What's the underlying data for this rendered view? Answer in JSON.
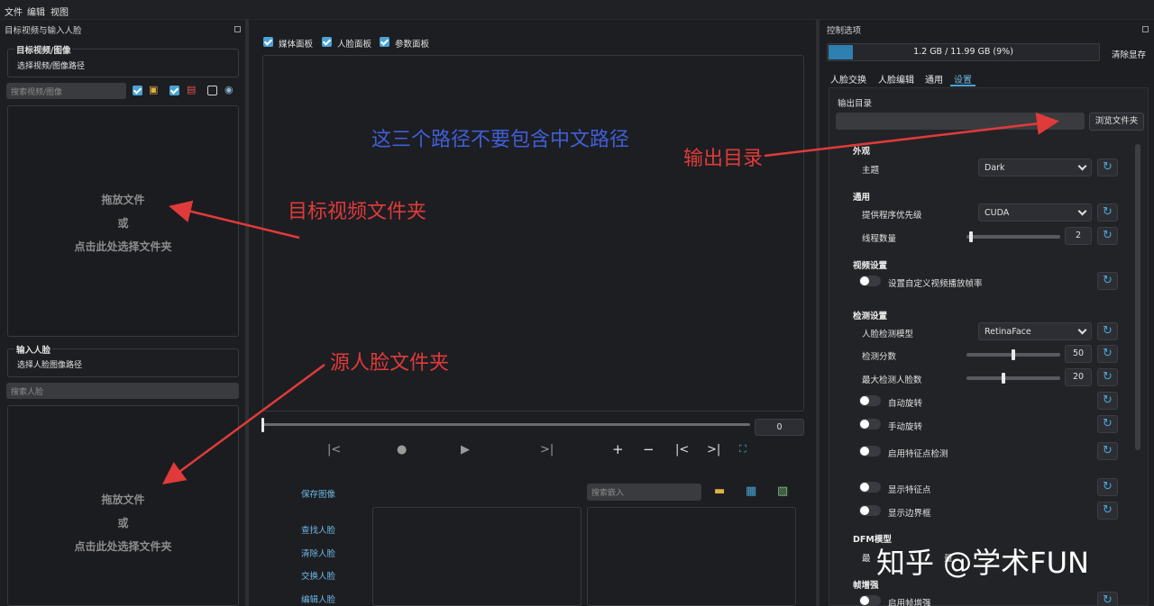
{
  "menu": {
    "file": "文件",
    "edit": "编辑",
    "view": "视图"
  },
  "left": {
    "dock_title": "目标视频与输入人脸",
    "target_group_title": "目标视频/图像",
    "target_path_placeholder": "选择视频/图像路径",
    "search_media_placeholder": "搜索视频/图像",
    "dropzone_line1": "拖放文件",
    "dropzone_line2": "或",
    "dropzone_line3": "点击此处选择文件夹",
    "input_face_group_title": "输入人脸",
    "face_path_placeholder": "选择人脸图像路径",
    "search_face_placeholder": "搜索人脸",
    "dropzone2_line1": "拖放文件",
    "dropzone2_line2": "或",
    "dropzone2_line3": "点击此处选择文件夹"
  },
  "center": {
    "checkbox_media": "媒体面板",
    "checkbox_face": "人脸面板",
    "checkbox_params": "参数面板",
    "frame_value": "0",
    "save_image": "保存图像",
    "search_embed_placeholder": "搜索嵌入",
    "find_face": "查找人脸",
    "clear_face": "清除人脸",
    "swap_face": "交换人脸",
    "edit_face": "编辑人脸"
  },
  "right": {
    "dock_title": "控制选项",
    "vram_text": "1.2 GB / 11.99 GB (9%)",
    "vram_fraction": 0.09,
    "clear_vram": "清除显存",
    "tabs": [
      "人脸交换",
      "人脸编辑",
      "通用",
      "设置"
    ],
    "active_tab": "设置",
    "output_dir_label": "输出目录",
    "browse_folder": "浏览文件夹",
    "sections": {
      "appearance": "外观",
      "general": "通用",
      "video_settings": "视频设置",
      "detection_settings": "检测设置",
      "dfm_model": "DFM模型",
      "frame_enhance": "帧增强"
    },
    "theme_label": "主题",
    "theme_value": "Dark",
    "provider_label": "提供程序优先级",
    "provider_value": "CUDA",
    "threads_label": "线程数量",
    "threads_value": "2",
    "custom_fps_label": "设置自定义视频播放帧率",
    "detect_model_label": "人脸检测模型",
    "detect_model_value": "RetinaFace",
    "detect_score_label": "检测分数",
    "detect_score_value": "50",
    "max_faces_label": "最大检测人脸数",
    "max_faces_value": "20",
    "auto_rotate_label": "自动旋转",
    "manual_rotate_label": "手动旋转",
    "landmark_detect_label": "启用特征点检测",
    "show_landmarks_label": "显示特征点",
    "show_bbox_label": "显示边界框",
    "dfm_partial_label": "最",
    "dfm_partial_label2": "量",
    "enable_frame_enhance_label": "启用帧增强"
  },
  "annotations": {
    "no_chinese_paths": "这三个路径不要包含中文路径",
    "output_dir": "输出目录",
    "target_video_folder": "目标视频文件夹",
    "source_face_folder": "源人脸文件夹"
  },
  "watermark": "知乎 @学术FUN"
}
